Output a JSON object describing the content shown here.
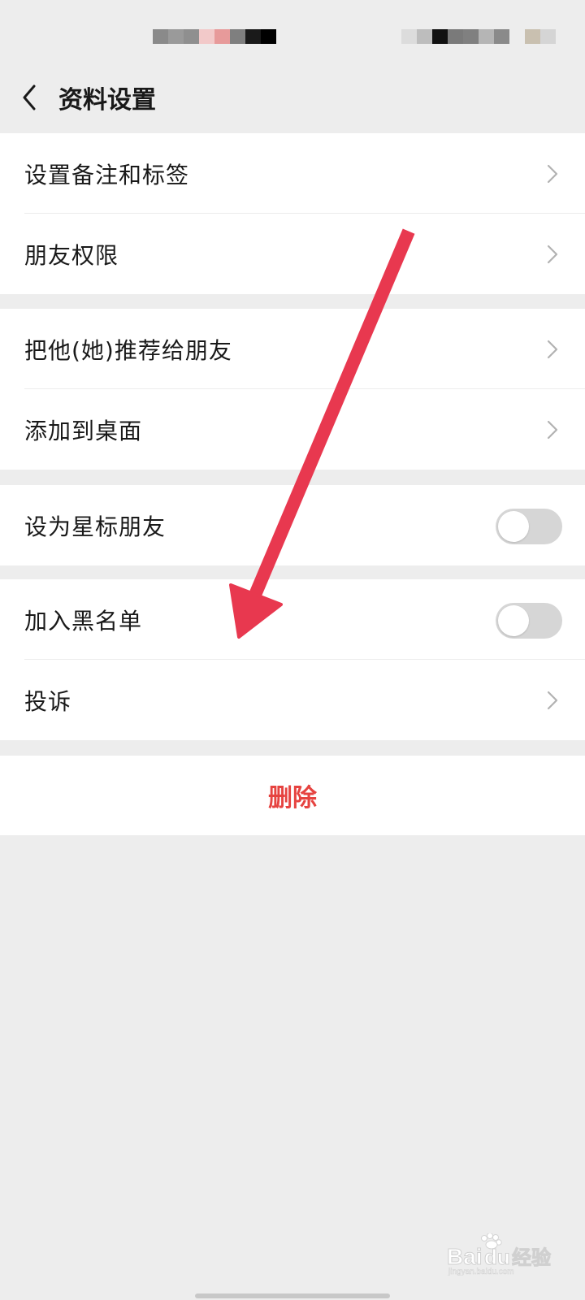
{
  "header": {
    "title": "资料设置"
  },
  "groups": [
    {
      "items": [
        {
          "label": "设置备注和标签",
          "control": "chevron"
        },
        {
          "label": "朋友权限",
          "control": "chevron"
        }
      ]
    },
    {
      "items": [
        {
          "label": "把他(她)推荐给朋友",
          "control": "chevron"
        },
        {
          "label": "添加到桌面",
          "control": "chevron"
        }
      ]
    },
    {
      "items": [
        {
          "label": "设为星标朋友",
          "control": "toggle",
          "checked": false
        }
      ]
    },
    {
      "items": [
        {
          "label": "加入黑名单",
          "control": "toggle",
          "checked": false
        },
        {
          "label": "投诉",
          "control": "chevron"
        }
      ]
    }
  ],
  "delete": {
    "label": "删除",
    "color": "#e64340"
  },
  "annotation": {
    "arrow_color": "#e8384f"
  },
  "watermark": {
    "text": "Baidu经验",
    "subtext": "jingyan.baidu.com"
  },
  "colors": {
    "background": "#ededed",
    "toggle_off": "#d6d6d6"
  }
}
